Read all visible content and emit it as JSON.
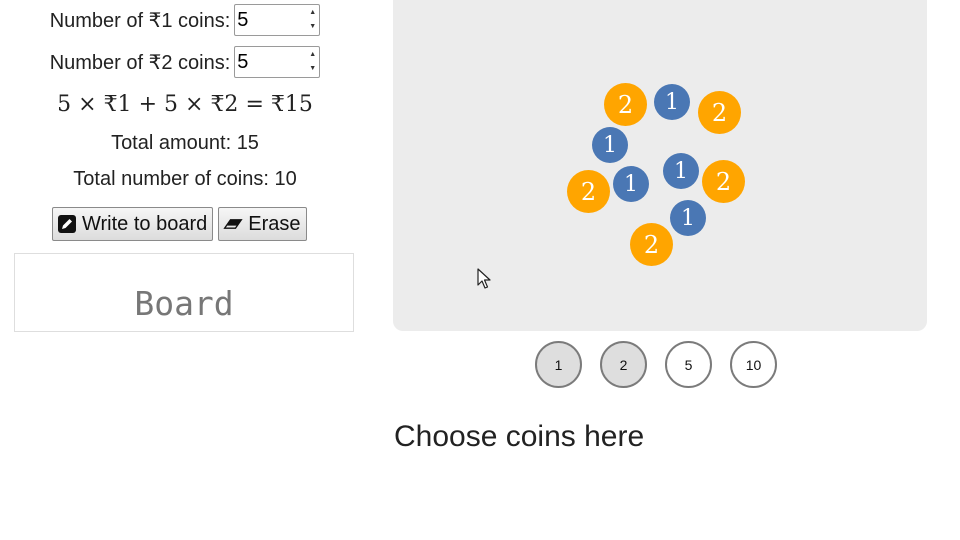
{
  "inputs": {
    "one_label": "Number of ₹1 coins:",
    "one_value": "5",
    "two_label": "Number of ₹2 coins:",
    "two_value": "5"
  },
  "formula": {
    "a": "5",
    "times1": "×",
    "c1": "₹1",
    "plus": "+",
    "b": "5",
    "times2": "×",
    "c2": "₹2",
    "eq": "=",
    "total": "₹15"
  },
  "summary": {
    "total_amount": "Total amount: 15",
    "total_coins": "Total number of coins: 10"
  },
  "buttons": {
    "write": "Write to board",
    "erase": "Erase"
  },
  "board": {
    "label": "Board"
  },
  "coins": {
    "c2a": "2",
    "c1a": "1",
    "c2b": "2",
    "c1b": "1",
    "c1c": "1",
    "c2c": "2",
    "c1d": "1",
    "c2d": "2",
    "c1e": "1",
    "c2e": "2"
  },
  "choices": [
    {
      "label": "1",
      "selected": true
    },
    {
      "label": "2",
      "selected": true
    },
    {
      "label": "5",
      "selected": false
    },
    {
      "label": "10",
      "selected": false
    }
  ],
  "footer": {
    "choose": "Choose coins here"
  },
  "colors": {
    "coin_one": "#4a77b4",
    "coin_two": "#ffa500",
    "panel": "#ececec"
  }
}
